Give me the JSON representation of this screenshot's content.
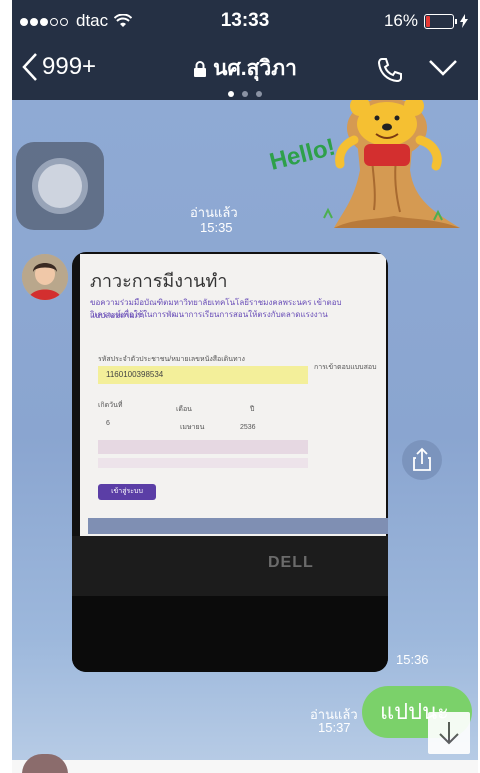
{
  "status_bar": {
    "carrier": "dtac",
    "time": "13:33",
    "battery_percent": "16%",
    "battery_level": 0.16,
    "signal_filled": 3,
    "signal_total": 5
  },
  "header": {
    "back_count": "999+",
    "chat_title": "นศ.สุวิภา",
    "page_dots": 3,
    "active_page": 1
  },
  "messages": [
    {
      "type": "sticker",
      "text": "Hello!",
      "read_label": "อ่านแล้ว",
      "time": "15:35"
    },
    {
      "type": "image",
      "time": "15:36"
    },
    {
      "type": "text",
      "text": "แปปนะ",
      "read_label": "อ่านแล้ว",
      "time": "15:37"
    }
  ],
  "photo": {
    "title": "ภาวะการมีงานทำ",
    "line1": "ขอความร่วมมือบัณฑิตมหาวิทยาลัยเทคโนโลยีราชมงคลพระนคร เข้าตอบแบบสอบถามภา",
    "line2": "วิเคราะห์เพื่อใช้ในการพัฒนาการเรียนการสอนให้ตรงกับตลาดแรงงาน",
    "id_label": "รหัสประจำตัวประชาชน/หมายเลขหนังสือเดินทาง",
    "id_value": "1160100398534",
    "birth_day_label": "เกิดวันที่",
    "month_label": "เดือน",
    "year_label": "ปี",
    "day_value": "6",
    "month_value": "เมษายน",
    "year_value": "2536",
    "steps_label": "การเข้าตอบแบบสอบ",
    "start_button": "เข้าสู่ระบบ",
    "brand": "DELL"
  },
  "colors": {
    "bar": "#253044",
    "bubble": "#7bd16a",
    "chat_bg": "#8faad4"
  }
}
